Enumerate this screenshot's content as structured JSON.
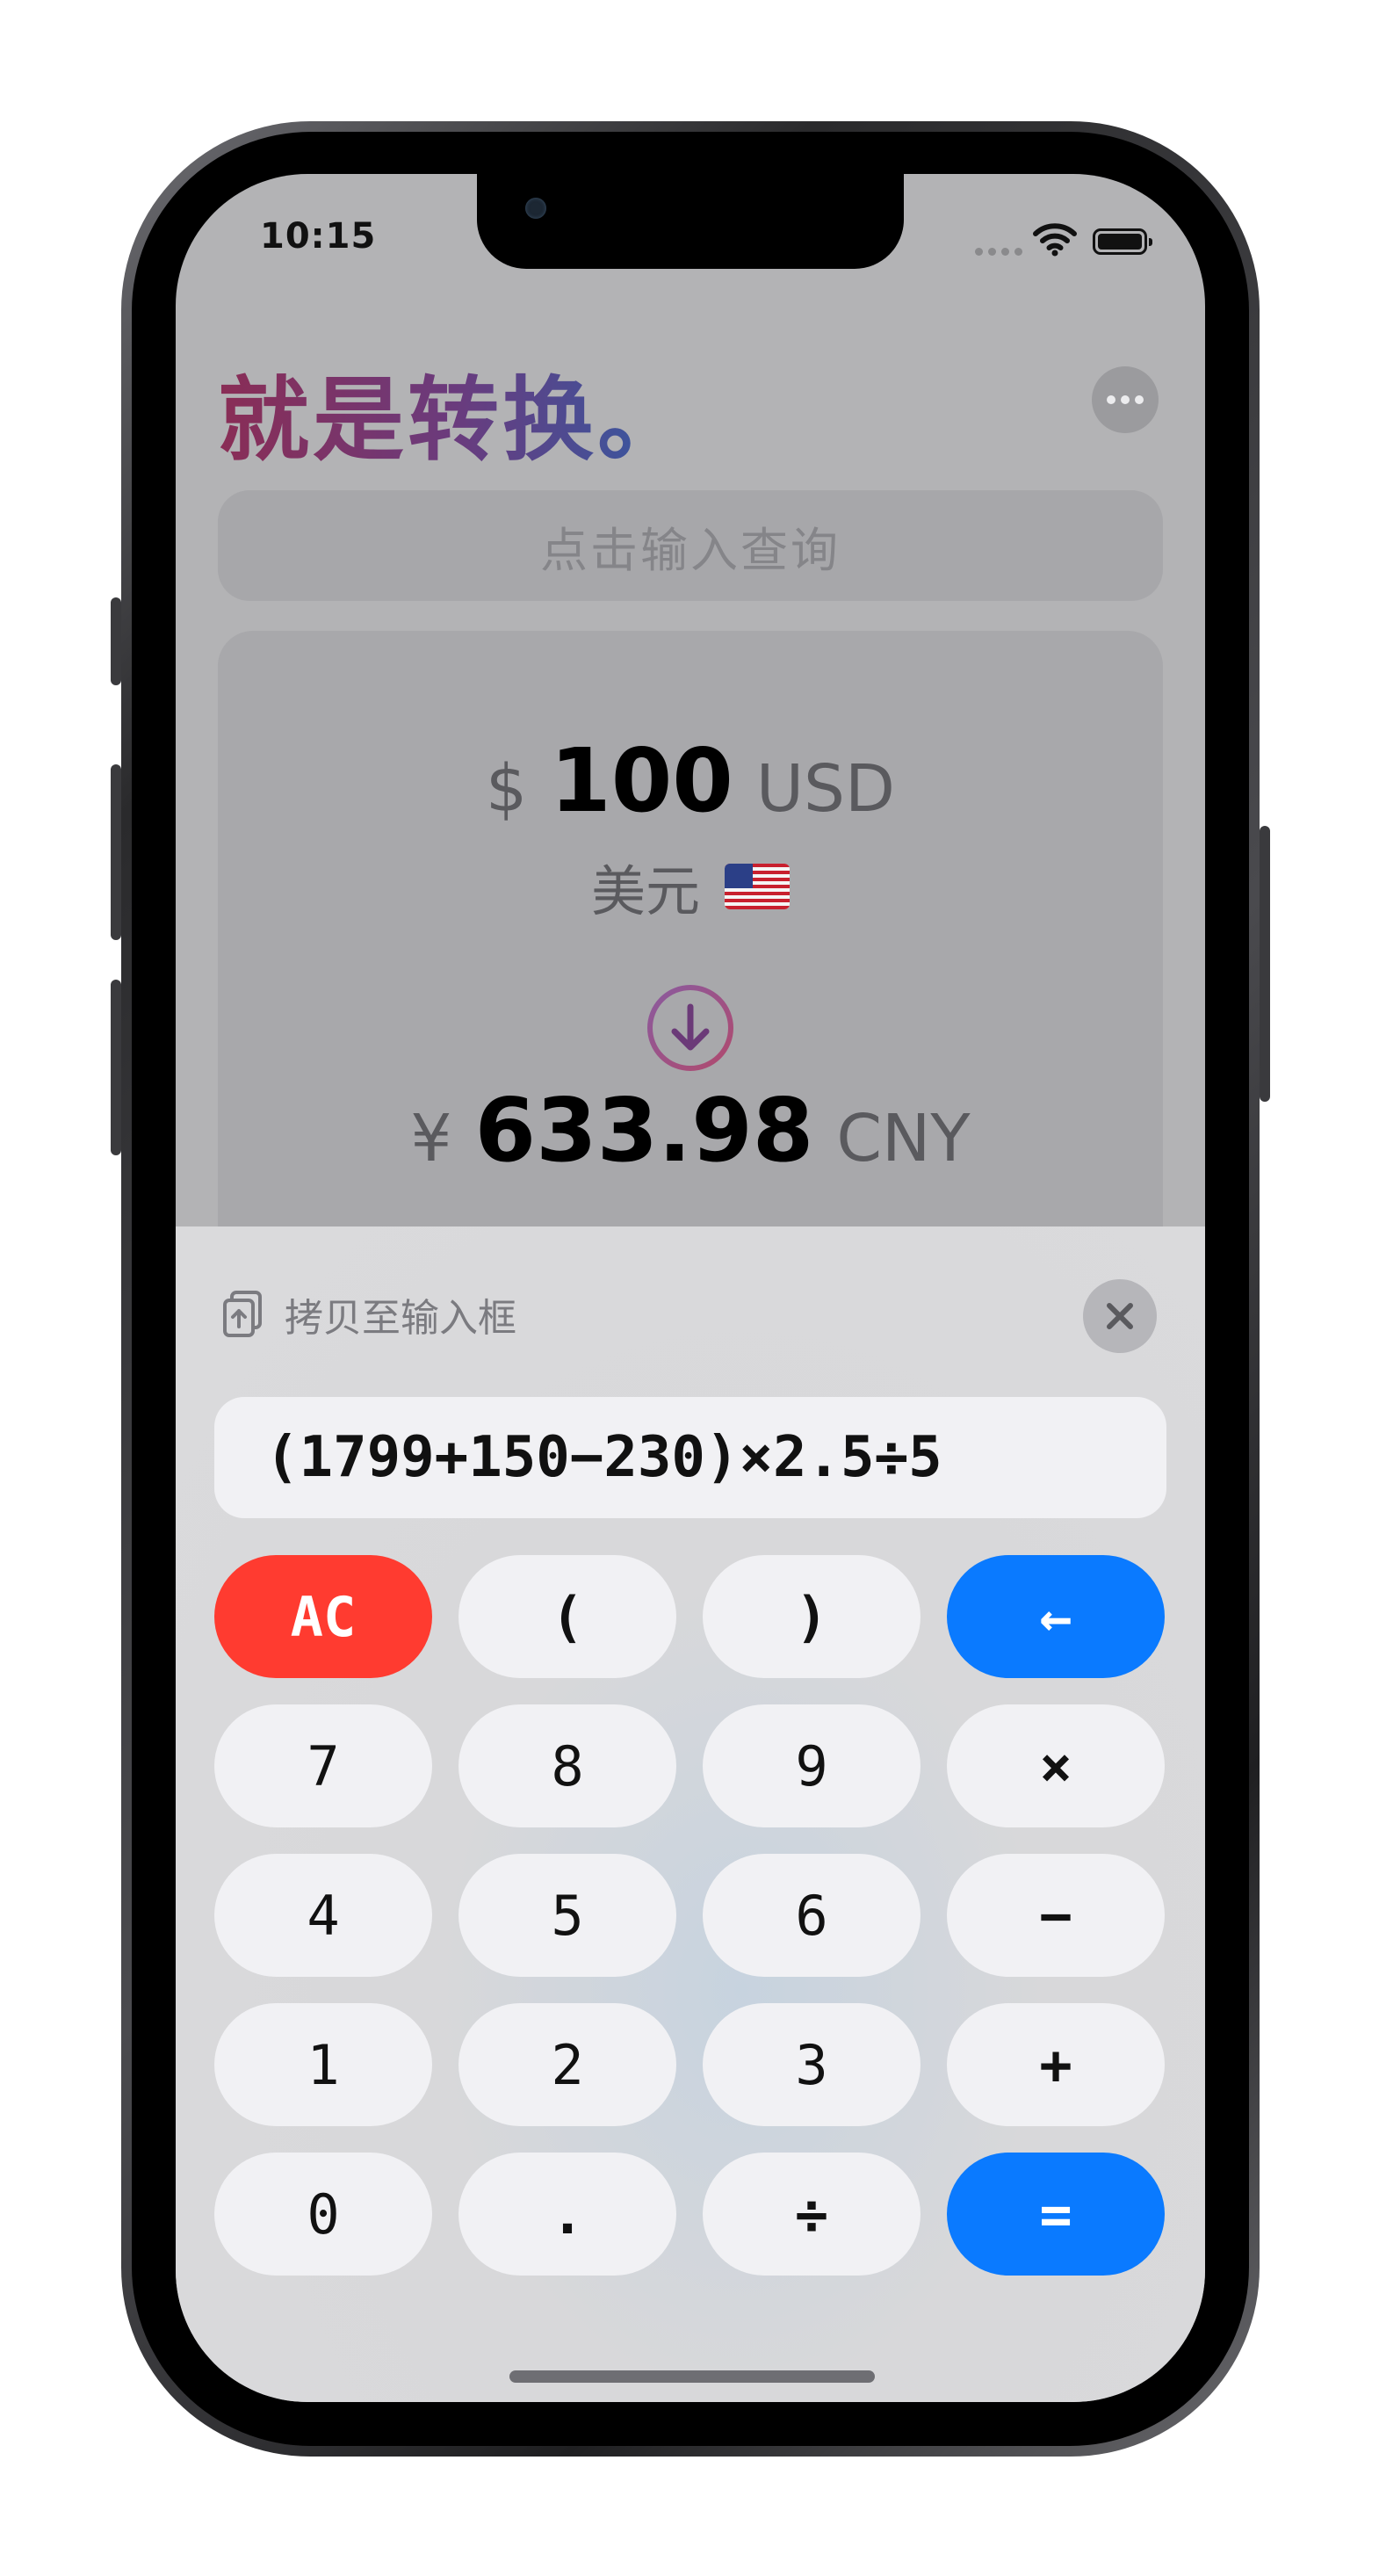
{
  "status_bar": {
    "time": "10:15"
  },
  "app": {
    "title": "就是转换。",
    "more_icon": "ellipsis-icon"
  },
  "search": {
    "placeholder": "点击输入查询"
  },
  "conversion": {
    "from": {
      "symbol": "$",
      "amount": "100",
      "code": "USD",
      "name": "美元",
      "flag": "us-flag-icon"
    },
    "to": {
      "symbol": "¥",
      "amount": "633.98",
      "code": "CNY"
    },
    "swap_icon": "arrow-down-circle-icon"
  },
  "calculator": {
    "copy_label": "拷贝至输入框",
    "copy_icon": "copy-to-clipboard-icon",
    "close_icon": "close-icon",
    "expression": "(1799+150−230)×2.5÷5",
    "keys": [
      [
        "AC",
        "(",
        ")",
        "←"
      ],
      [
        "7",
        "8",
        "9",
        "×"
      ],
      [
        "4",
        "5",
        "6",
        "−"
      ],
      [
        "1",
        "2",
        "3",
        "+"
      ],
      [
        "0",
        ".",
        "÷",
        "="
      ]
    ]
  },
  "colors": {
    "accent_blue": "#0a7aff",
    "clear_red": "#ff3b30",
    "title_gradient_start": "#8a2d55",
    "title_gradient_end": "#2f5ca6"
  }
}
